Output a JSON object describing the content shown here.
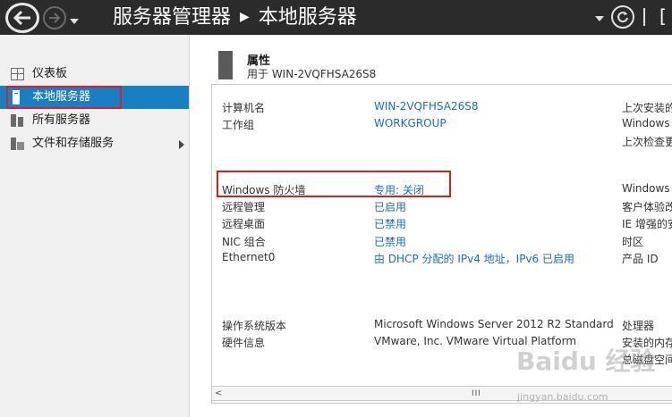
{
  "titlebar": {
    "breadcrumb_root": "服务器管理器",
    "breadcrumb_current": "本地服务器",
    "menu_partial": "[",
    "separator": "|"
  },
  "sidebar": {
    "items": [
      {
        "label": "仪表板",
        "icon": "dashboard-icon"
      },
      {
        "label": "本地服务器",
        "icon": "server-icon",
        "active": true
      },
      {
        "label": "所有服务器",
        "icon": "servers-icon"
      },
      {
        "label": "文件和存储服务",
        "icon": "storage-icon",
        "has_submenu": true
      }
    ]
  },
  "properties": {
    "title": "属性",
    "subtitle": "用于 WIN-2VQFHSA26S8",
    "rows_top": [
      {
        "label": "计算机名",
        "value": "WIN-2VQFHSA26S8"
      },
      {
        "label": "工作组",
        "value": "WORKGROUP"
      }
    ],
    "rows_mid": [
      {
        "label": "Windows 防火墙",
        "value": "专用: 关闭"
      },
      {
        "label": "远程管理",
        "value": "已启用"
      },
      {
        "label": "远程桌面",
        "value": "已禁用"
      },
      {
        "label": "NIC 组合",
        "value": "已禁用"
      },
      {
        "label": "Ethernet0",
        "value": "由 DHCP 分配的 IPv4 地址，IPv6 已启用"
      }
    ],
    "rows_bottom": [
      {
        "label": "操作系统版本",
        "value": "Microsoft Windows Server 2012 R2 Standard"
      },
      {
        "label": "硬件信息",
        "value": "VMware, Inc. VMware Virtual Platform"
      }
    ],
    "right_col": {
      "top": [
        "上次安装的",
        "Windows",
        "上次检查更"
      ],
      "mid": [
        "Windows",
        "客户体验改",
        "IE 增强的安",
        "时区",
        "产品 ID"
      ],
      "bottom": [
        "处理器",
        "安装的内存",
        "总磁盘空间"
      ]
    }
  },
  "scrollbar": {
    "left_arrow": "<",
    "thumb": "III"
  },
  "watermark": {
    "text": "Baidu 经验",
    "sub": "jingyan.baidu.com"
  },
  "colors": {
    "titlebar": "#2b2b2b",
    "active": "#1a7fc2",
    "link": "#1a6fb5",
    "highlight": "#d02020"
  }
}
